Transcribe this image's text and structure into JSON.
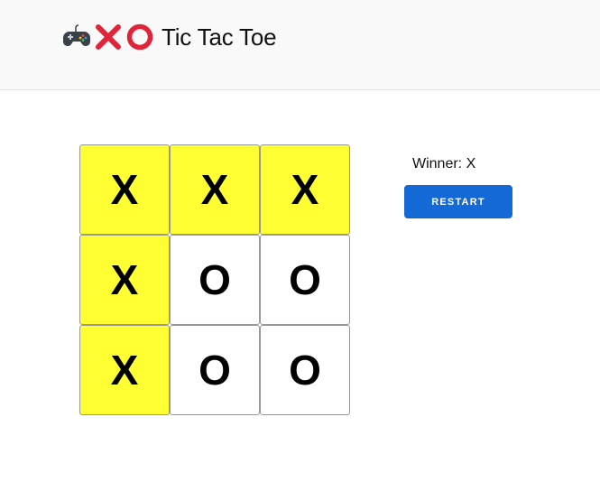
{
  "header": {
    "title": "Tic Tac Toe",
    "icons": [
      "gamepad-icon",
      "cross-mark-icon",
      "circle-mark-icon"
    ]
  },
  "board": {
    "cells": [
      {
        "value": "X",
        "winning": true
      },
      {
        "value": "X",
        "winning": true
      },
      {
        "value": "X",
        "winning": true
      },
      {
        "value": "X",
        "winning": true
      },
      {
        "value": "O",
        "winning": false
      },
      {
        "value": "O",
        "winning": false
      },
      {
        "value": "X",
        "winning": true
      },
      {
        "value": "O",
        "winning": false
      },
      {
        "value": "O",
        "winning": false
      }
    ]
  },
  "status": {
    "text": "Winner: X"
  },
  "controls": {
    "restart_label": "RESTART"
  },
  "colors": {
    "win_highlight": "#ffff33",
    "button": "#1469d6",
    "header_bg": "#f9f9f9"
  }
}
